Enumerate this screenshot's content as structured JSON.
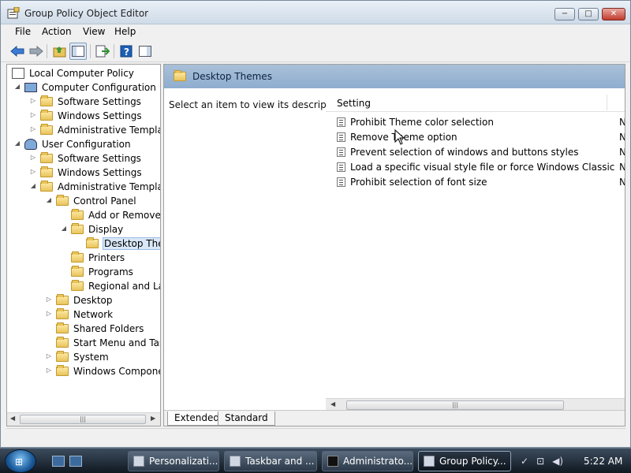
{
  "window": {
    "title": "Group Policy Object Editor",
    "buttons": {
      "minimize": "−",
      "maximize": "□",
      "close": "✕"
    }
  },
  "menu": [
    "File",
    "Action",
    "View",
    "Help"
  ],
  "toolbar": {
    "icons": [
      "back-arrow-icon",
      "forward-arrow-icon",
      "up-folder-icon",
      "show-hide-tree-icon",
      "export-list-icon",
      "help-icon",
      "show-hide-console-icon"
    ]
  },
  "tree": {
    "root": "Local Computer Policy",
    "computer_config": "Computer Configuration",
    "software_settings": "Software Settings",
    "windows_settings": "Windows Settings",
    "admin_templates": "Administrative Template",
    "user_config": "User Configuration",
    "user_software_settings": "Software Settings",
    "user_windows_settings": "Windows Settings",
    "user_admin_templates": "Administrative Template",
    "control_panel": "Control Panel",
    "add_remove": "Add or Remove P",
    "display": "Display",
    "desktop_themes": "Desktop Ther",
    "printers": "Printers",
    "programs": "Programs",
    "regional": "Regional and Lan",
    "desktop": "Desktop",
    "network": "Network",
    "shared_folders": "Shared Folders",
    "start_menu": "Start Menu and Task",
    "system": "System",
    "windows_components": "Windows Componer"
  },
  "right": {
    "header": "Desktop Themes",
    "description": "Select an item to view its description.",
    "column": "Setting",
    "settings": [
      {
        "name": "Prohibit Theme color selection",
        "state": "Nc"
      },
      {
        "name": "Remove Theme option",
        "state": "Nc"
      },
      {
        "name": "Prevent selection of windows and buttons styles",
        "state": "Nc"
      },
      {
        "name": "Load a specific visual style file or force Windows Classic",
        "state": "Nc"
      },
      {
        "name": "Prohibit selection of font size",
        "state": "Nc"
      }
    ],
    "tabs": [
      "Extended",
      "Standard"
    ]
  },
  "taskbar": {
    "start": "⊞",
    "buttons": [
      "Personalizati...",
      "Taskbar and ...",
      "Administrato...",
      "Group Policy..."
    ],
    "clock": "5:22 AM"
  }
}
